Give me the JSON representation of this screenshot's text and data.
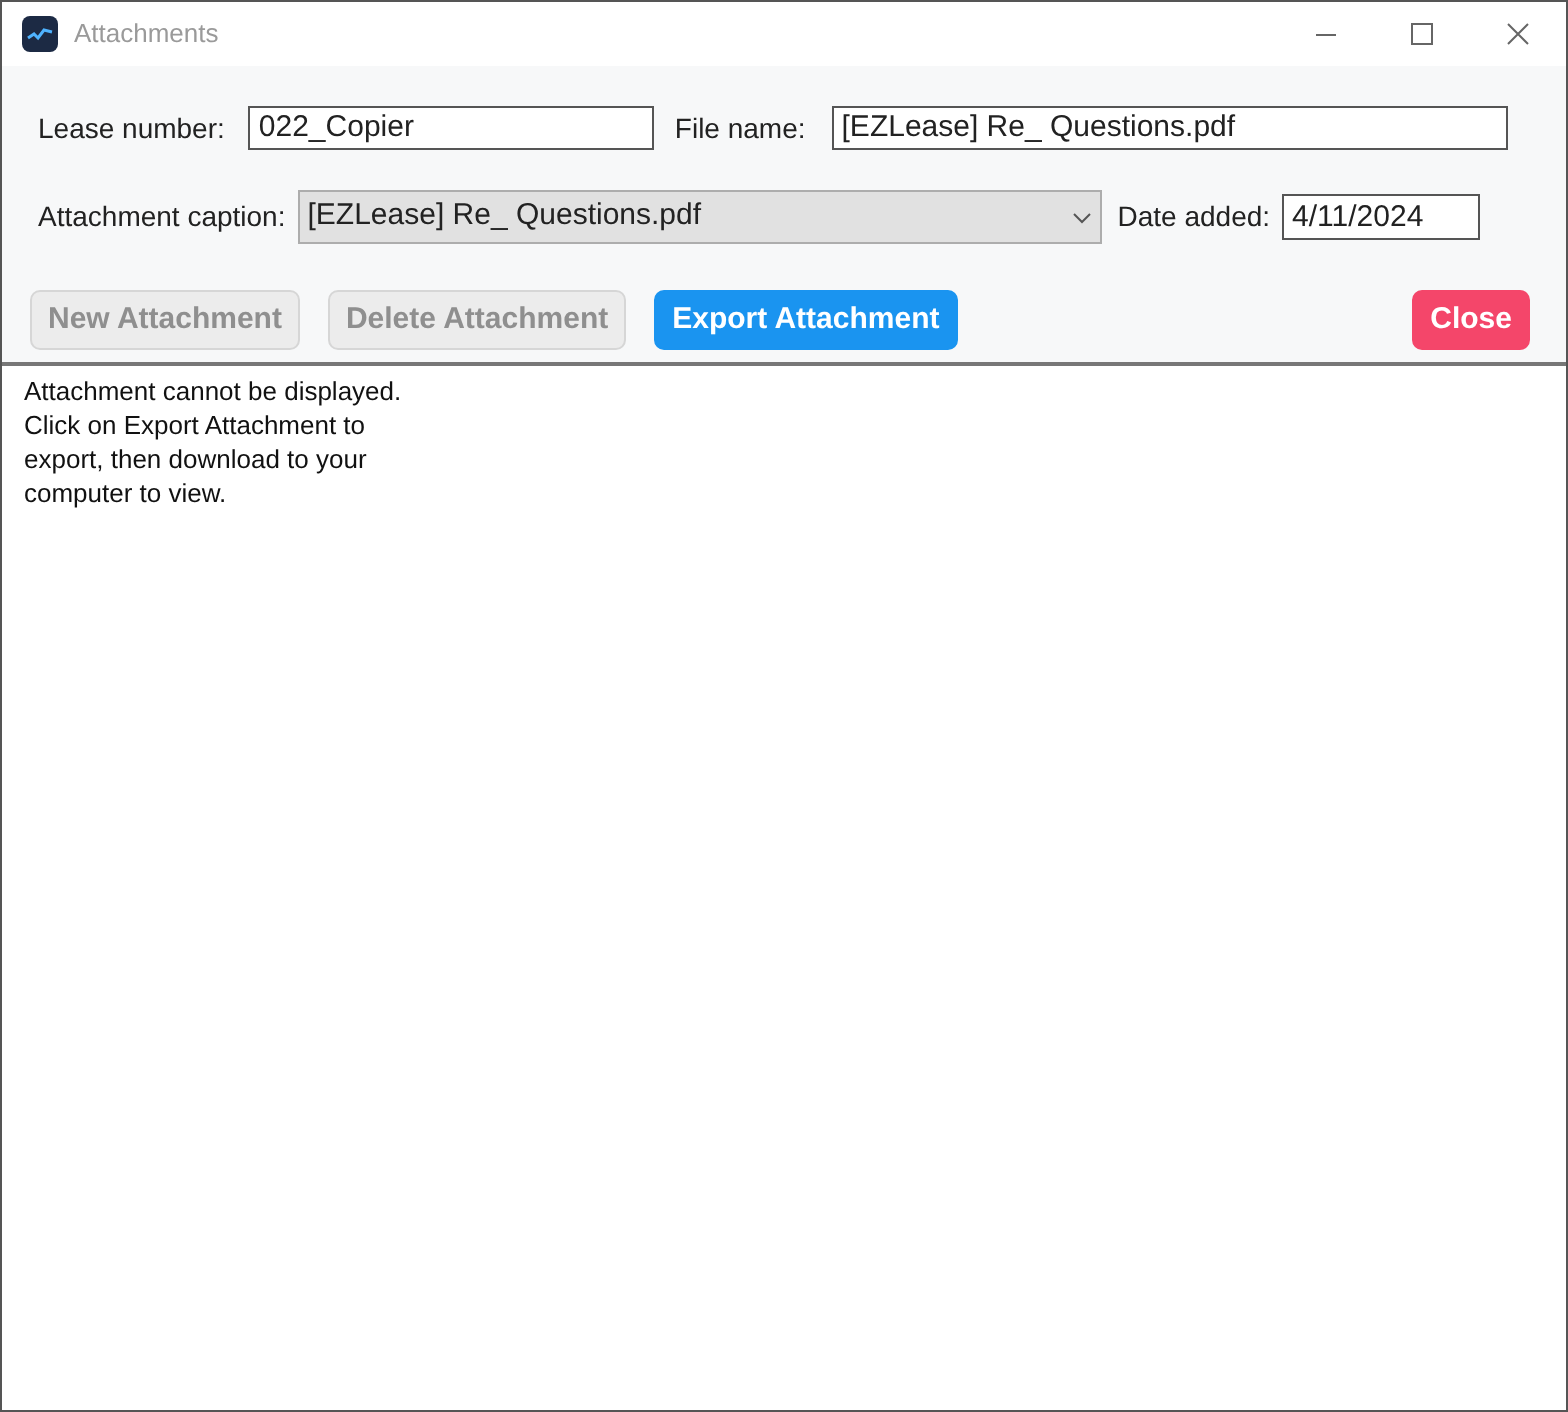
{
  "window": {
    "title": "Attachments"
  },
  "fields": {
    "lease_number": {
      "label": "Lease number:",
      "value": "022_Copier"
    },
    "file_name": {
      "label": "File name:",
      "value": "[EZLease] Re_ Questions.pdf"
    },
    "caption": {
      "label": "Attachment caption:",
      "value": "[EZLease] Re_ Questions.pdf"
    },
    "date_added": {
      "label": "Date added:",
      "value": "4/11/2024"
    }
  },
  "buttons": [
    {
      "label": "New Attachment",
      "kind": "plain",
      "disabled": true
    },
    {
      "label": "Delete Attachment",
      "kind": "plain",
      "disabled": true
    },
    {
      "label": "Export Attachment",
      "kind": "primary",
      "disabled": false
    },
    {
      "label": "Close",
      "kind": "danger",
      "disabled": false
    }
  ],
  "message": [
    "Attachment cannot be displayed.",
    "Click on Export Attachment to",
    "export, then download to your",
    "computer to view."
  ]
}
